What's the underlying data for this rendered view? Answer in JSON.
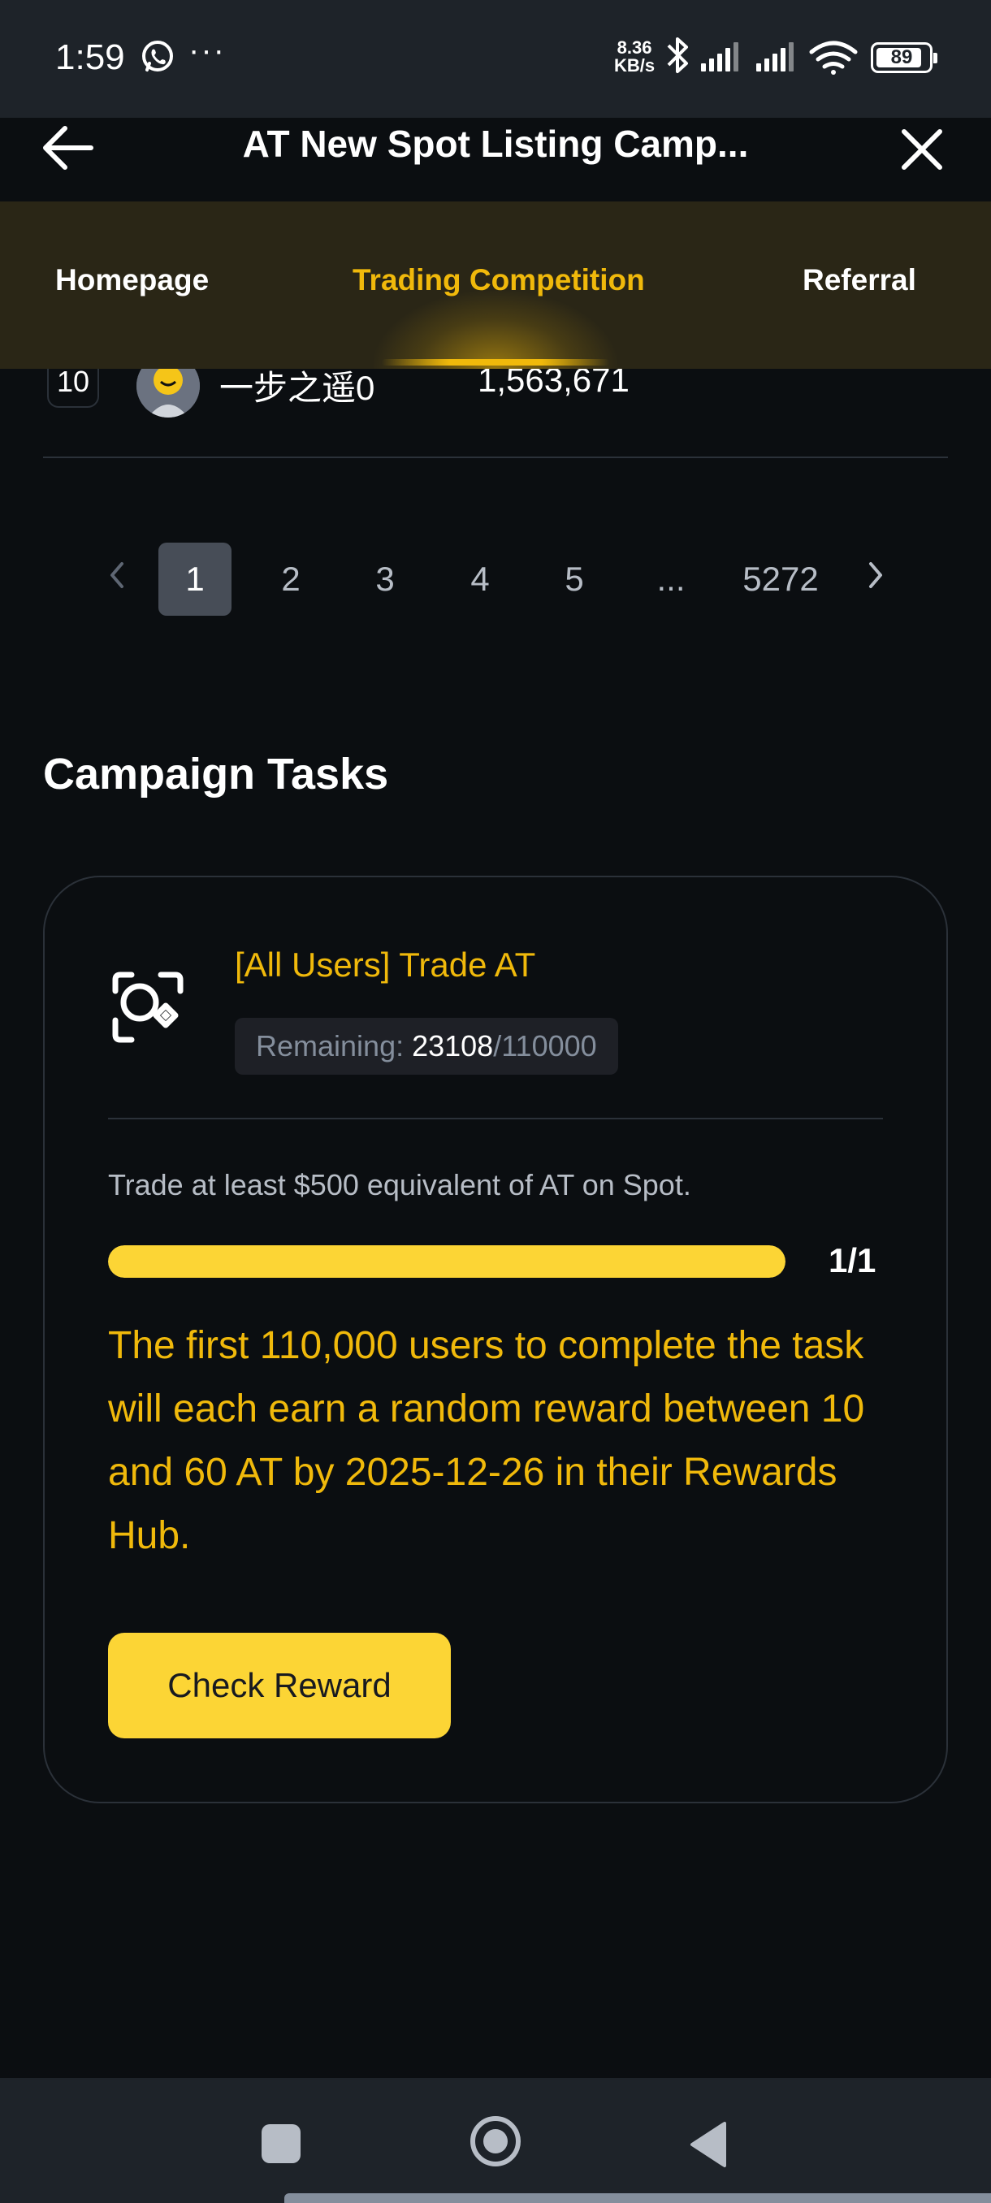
{
  "status_bar": {
    "time": "1:59",
    "dots": "···",
    "net_speed_value": "8.36",
    "net_speed_unit": "KB/s",
    "battery": "89",
    "battery_level": 0.89
  },
  "header": {
    "title": "AT New Spot Listing Camp..."
  },
  "tabs": [
    {
      "label": "Homepage",
      "active": false
    },
    {
      "label": "Trading Competition",
      "active": true
    },
    {
      "label": "Referral",
      "active": false
    }
  ],
  "leaderboard_row": {
    "rank": "10",
    "name": "一步之遥0",
    "volume": "1,563,671"
  },
  "pagination": {
    "pages": [
      "1",
      "2",
      "3",
      "4",
      "5",
      "...",
      "5272"
    ],
    "current": "1"
  },
  "campaign": {
    "section_title": "Campaign Tasks",
    "task": {
      "title": "[All Users] Trade AT",
      "remaining_label": "Remaining: ",
      "remaining_current": "23108",
      "remaining_total": "/110000",
      "description": "Trade at least $500 equivalent of AT on Spot.",
      "progress_label": "1/1",
      "progress_fraction": 1.0,
      "reward_text": "The first 110,000 users to complete the task will each earn a random reward between 10 and 60 AT by 2025-12-26 in their Rewards Hub.",
      "button_label": "Check Reward"
    }
  },
  "colors": {
    "accent": "#f0b90b",
    "button": "#fcd535",
    "background": "#0b0e11"
  }
}
